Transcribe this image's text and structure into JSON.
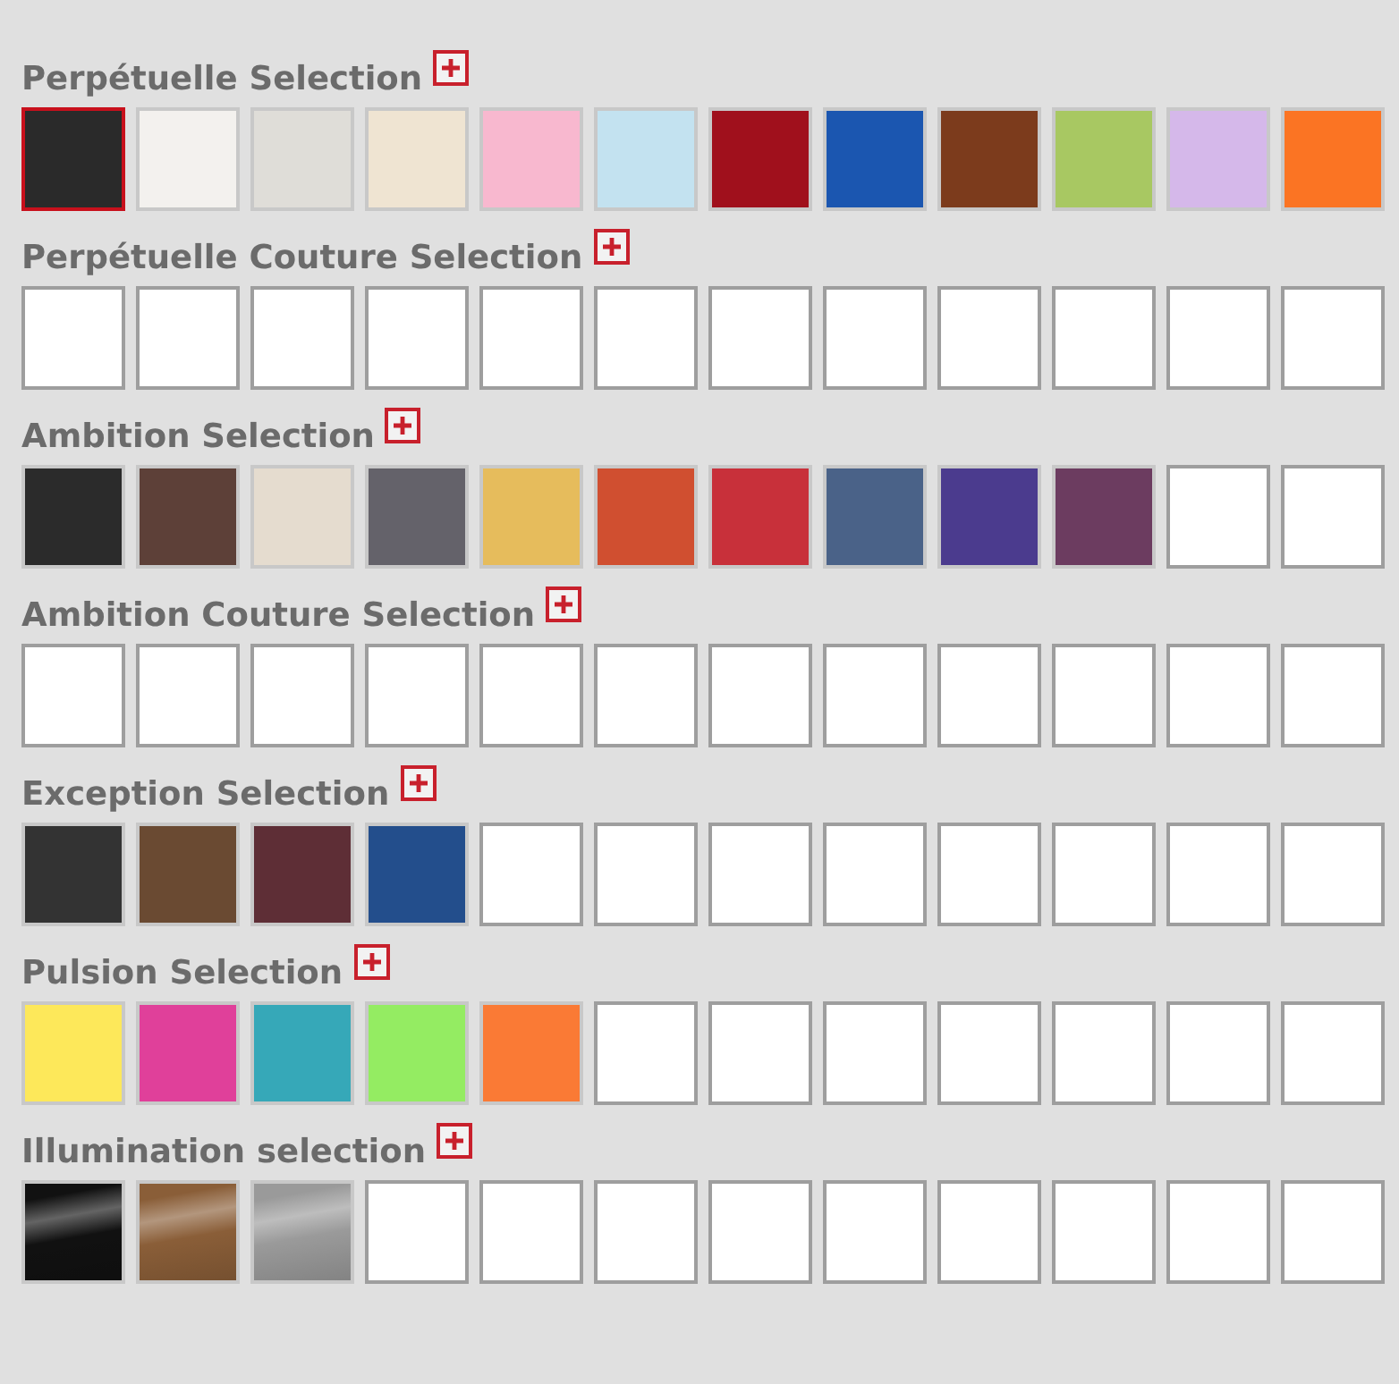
{
  "sections": [
    {
      "title": "Perpétuelle Selection",
      "swatches": [
        {
          "kind": "color",
          "color": "#2a2a2a",
          "selected": true
        },
        {
          "kind": "color",
          "color": "#f3f1ee",
          "selected": false
        },
        {
          "kind": "color",
          "color": "#dfddd8",
          "selected": false
        },
        {
          "kind": "color",
          "color": "#efe4d2",
          "selected": false
        },
        {
          "kind": "color",
          "color": "#f8b8cf",
          "selected": false
        },
        {
          "kind": "color",
          "color": "#c3e2f0",
          "selected": false
        },
        {
          "kind": "color",
          "color": "#a0101c",
          "selected": false
        },
        {
          "kind": "color",
          "color": "#1b56b0",
          "selected": false
        },
        {
          "kind": "color",
          "color": "#7c3b1c",
          "selected": false
        },
        {
          "kind": "color",
          "color": "#a8c862",
          "selected": false
        },
        {
          "kind": "color",
          "color": "#d5b8ea",
          "selected": false
        },
        {
          "kind": "color",
          "color": "#fb7423",
          "selected": false
        }
      ]
    },
    {
      "title": "Perpétuelle Couture Selection",
      "swatches": [
        {
          "kind": "empty",
          "selected": false
        },
        {
          "kind": "empty",
          "selected": false
        },
        {
          "kind": "empty",
          "selected": false
        },
        {
          "kind": "empty",
          "selected": false
        },
        {
          "kind": "empty",
          "selected": false
        },
        {
          "kind": "empty",
          "selected": false
        },
        {
          "kind": "empty",
          "selected": false
        },
        {
          "kind": "empty",
          "selected": false
        },
        {
          "kind": "empty",
          "selected": false
        },
        {
          "kind": "empty",
          "selected": false
        },
        {
          "kind": "empty",
          "selected": false
        },
        {
          "kind": "empty",
          "selected": false
        }
      ]
    },
    {
      "title": "Ambition Selection",
      "swatches": [
        {
          "kind": "color",
          "color": "#2b2b2b",
          "selected": false
        },
        {
          "kind": "color",
          "color": "#5d4038",
          "selected": false
        },
        {
          "kind": "color",
          "color": "#e5dccf",
          "selected": false
        },
        {
          "kind": "color",
          "color": "#64626a",
          "selected": false
        },
        {
          "kind": "color",
          "color": "#e6bc5c",
          "selected": false
        },
        {
          "kind": "color",
          "color": "#d04f30",
          "selected": false
        },
        {
          "kind": "color",
          "color": "#c8303a",
          "selected": false
        },
        {
          "kind": "color",
          "color": "#4a6288",
          "selected": false
        },
        {
          "kind": "color",
          "color": "#4b3b8e",
          "selected": false
        },
        {
          "kind": "color",
          "color": "#6c3c60",
          "selected": false
        },
        {
          "kind": "empty",
          "selected": false
        },
        {
          "kind": "empty",
          "selected": false
        }
      ]
    },
    {
      "title": "Ambition Couture Selection",
      "swatches": [
        {
          "kind": "empty",
          "selected": false
        },
        {
          "kind": "empty",
          "selected": false
        },
        {
          "kind": "empty",
          "selected": false
        },
        {
          "kind": "empty",
          "selected": false
        },
        {
          "kind": "empty",
          "selected": false
        },
        {
          "kind": "empty",
          "selected": false
        },
        {
          "kind": "empty",
          "selected": false
        },
        {
          "kind": "empty",
          "selected": false
        },
        {
          "kind": "empty",
          "selected": false
        },
        {
          "kind": "empty",
          "selected": false
        },
        {
          "kind": "empty",
          "selected": false
        },
        {
          "kind": "empty",
          "selected": false
        }
      ]
    },
    {
      "title": "Exception Selection",
      "swatches": [
        {
          "kind": "color",
          "color": "#333333",
          "selected": false
        },
        {
          "kind": "color",
          "color": "#6a4a32",
          "selected": false
        },
        {
          "kind": "color",
          "color": "#5e2e36",
          "selected": false
        },
        {
          "kind": "color",
          "color": "#234e8c",
          "selected": false
        },
        {
          "kind": "empty",
          "selected": false
        },
        {
          "kind": "empty",
          "selected": false
        },
        {
          "kind": "empty",
          "selected": false
        },
        {
          "kind": "empty",
          "selected": false
        },
        {
          "kind": "empty",
          "selected": false
        },
        {
          "kind": "empty",
          "selected": false
        },
        {
          "kind": "empty",
          "selected": false
        },
        {
          "kind": "empty",
          "selected": false
        }
      ]
    },
    {
      "title": "Pulsion Selection",
      "swatches": [
        {
          "kind": "color",
          "color": "#fde85a",
          "selected": false
        },
        {
          "kind": "color",
          "color": "#e0409a",
          "selected": false
        },
        {
          "kind": "color",
          "color": "#36a8b8",
          "selected": false
        },
        {
          "kind": "color",
          "color": "#94ec62",
          "selected": false
        },
        {
          "kind": "color",
          "color": "#fa7a35",
          "selected": false
        },
        {
          "kind": "empty",
          "selected": false
        },
        {
          "kind": "empty",
          "selected": false
        },
        {
          "kind": "empty",
          "selected": false
        },
        {
          "kind": "empty",
          "selected": false
        },
        {
          "kind": "empty",
          "selected": false
        },
        {
          "kind": "empty",
          "selected": false
        },
        {
          "kind": "empty",
          "selected": false
        }
      ]
    },
    {
      "title": "Illumination selection",
      "swatches": [
        {
          "kind": "metal",
          "color": "#111111",
          "selected": false
        },
        {
          "kind": "metal",
          "color": "#8a5e38",
          "selected": false
        },
        {
          "kind": "metal",
          "color": "#9a9a9a",
          "selected": false
        },
        {
          "kind": "empty",
          "selected": false
        },
        {
          "kind": "empty",
          "selected": false
        },
        {
          "kind": "empty",
          "selected": false
        },
        {
          "kind": "empty",
          "selected": false
        },
        {
          "kind": "empty",
          "selected": false
        },
        {
          "kind": "empty",
          "selected": false
        },
        {
          "kind": "empty",
          "selected": false
        },
        {
          "kind": "empty",
          "selected": false
        },
        {
          "kind": "empty",
          "selected": false
        }
      ]
    }
  ]
}
